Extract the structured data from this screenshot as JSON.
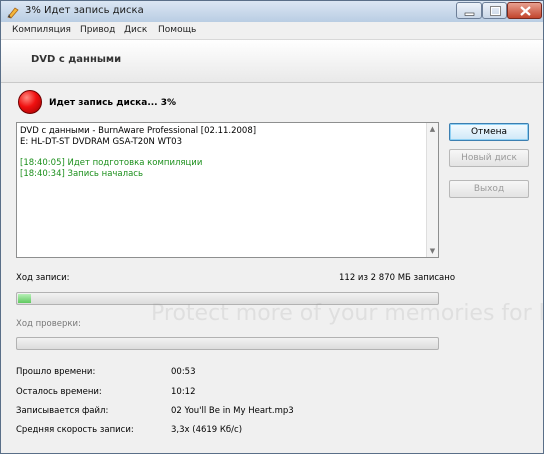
{
  "window": {
    "title": "3% Идет запись диска"
  },
  "menu": {
    "items": [
      "Компиляция",
      "Привод",
      "Диск",
      "Помощь"
    ]
  },
  "header": {
    "title": "DVD с данными"
  },
  "status": {
    "text": "Идет запись диска... 3%"
  },
  "log": {
    "lines": [
      "DVD с данными - BurnAware Professional [02.11.2008]",
      "E: HL-DT-ST DVDRAM GSA-T20N WT03",
      "",
      "[18:40:05] Идет подготовка компиляции",
      "[18:40:34] Запись началась"
    ]
  },
  "buttons": {
    "cancel": "Отмена",
    "new_disc": "Новый диск",
    "exit": "Выход"
  },
  "progress": {
    "write_label": "Ход записи:",
    "write_info": "112 из 2 870 МБ записано",
    "write_fraction": 0.03,
    "verify_label": "Ход проверки:",
    "verify_fraction": 0
  },
  "stats": {
    "elapsed_label": "Прошло времени:",
    "elapsed_value": "00:53",
    "remaining_label": "Осталось времени:",
    "remaining_value": "10:12",
    "file_label": "Записывается файл:",
    "file_value": "02 You'll Be in My Heart.mp3",
    "speed_label": "Средняя скорость записи:",
    "speed_value": "3,3x (4619 Кб/с)"
  },
  "watermark": "Protect more of your memories for less!"
}
